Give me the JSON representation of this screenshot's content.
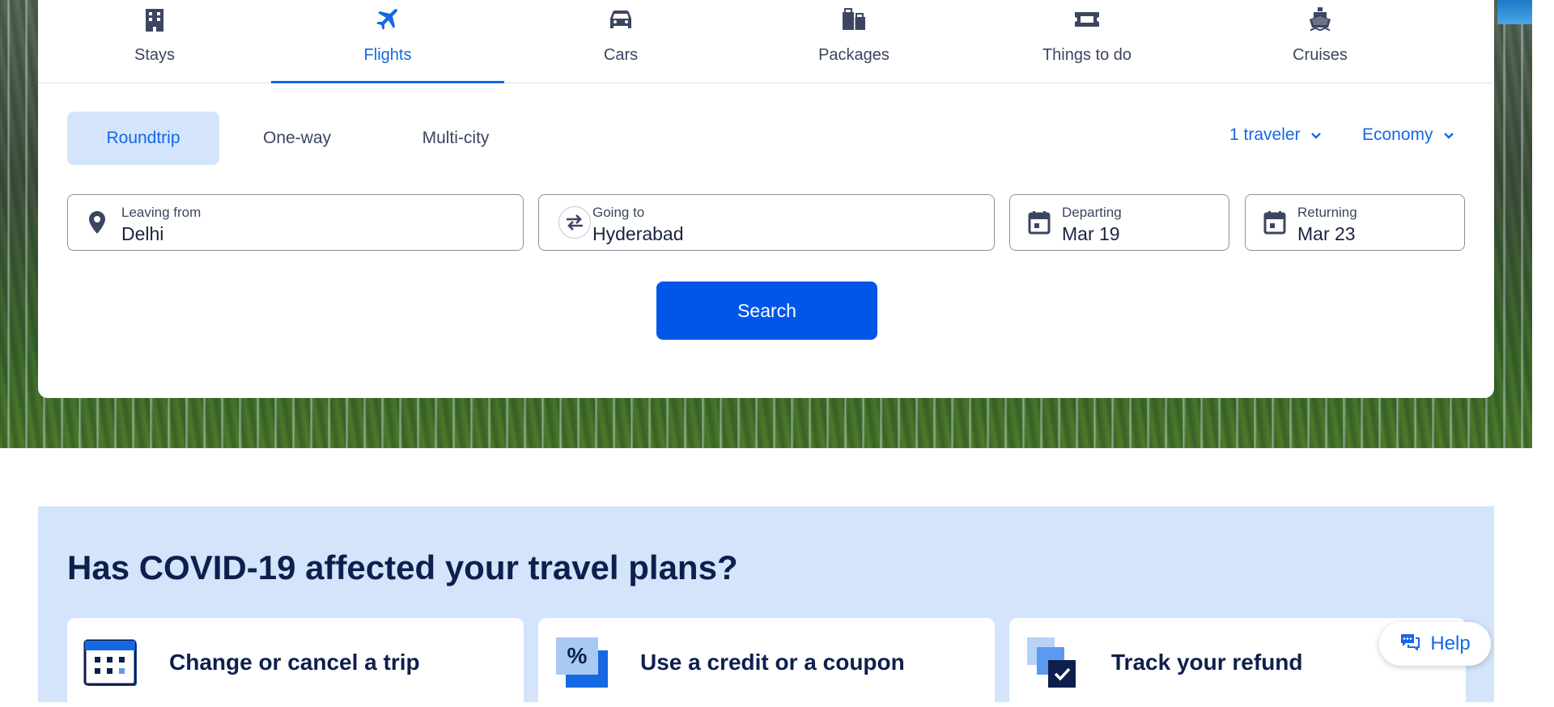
{
  "tabs": [
    {
      "label": "Stays",
      "icon": "building-icon"
    },
    {
      "label": "Flights",
      "icon": "plane-icon",
      "active": true
    },
    {
      "label": "Cars",
      "icon": "car-icon"
    },
    {
      "label": "Packages",
      "icon": "packages-icon"
    },
    {
      "label": "Things to do",
      "icon": "ticket-icon"
    },
    {
      "label": "Cruises",
      "icon": "cruise-ship-icon"
    }
  ],
  "trip_types": [
    {
      "label": "Roundtrip",
      "active": true
    },
    {
      "label": "One-way"
    },
    {
      "label": "Multi-city"
    }
  ],
  "travelers": {
    "label": "1 traveler"
  },
  "cabin_class": {
    "label": "Economy"
  },
  "fields": {
    "leaving_from": {
      "label": "Leaving from",
      "value": "Delhi"
    },
    "going_to": {
      "label": "Going to",
      "value": "Hyderabad"
    },
    "departing": {
      "label": "Departing",
      "value": "Mar 19"
    },
    "returning": {
      "label": "Returning",
      "value": "Mar 23"
    }
  },
  "search": {
    "label": "Search"
  },
  "covid": {
    "heading": "Has COVID-19 affected your travel plans?",
    "cards": [
      {
        "label": "Change or cancel a trip"
      },
      {
        "label": "Use a credit or a coupon"
      },
      {
        "label": "Track your refund"
      }
    ]
  },
  "help": {
    "label": "Help"
  },
  "colors": {
    "accent": "#1668e3",
    "search_button": "#0156e8",
    "active_pill": "#d4e4fb",
    "heading": "#0e1f4d",
    "covid_bg": "#d3e4fb"
  }
}
